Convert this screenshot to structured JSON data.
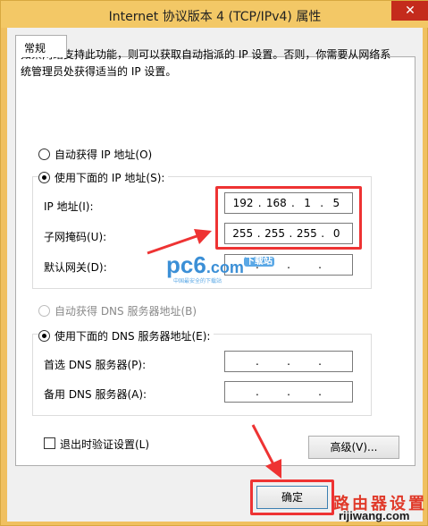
{
  "window": {
    "title": "Internet 协议版本 4 (TCP/IPv4) 属性",
    "close_glyph": "✕"
  },
  "tab": {
    "label": "常规"
  },
  "description": "如果网络支持此功能，则可以获取自动指派的 IP 设置。否则，你需要从网络系统管理员处获得适当的 IP 设置。",
  "ip_section": {
    "auto_label": "自动获得 IP 地址(O)",
    "manual_label": "使用下面的 IP 地址(S):",
    "manual_selected": true,
    "fields": [
      {
        "label": "IP 地址(I):",
        "octets": [
          "192",
          "168",
          "1",
          "5"
        ]
      },
      {
        "label": "子网掩码(U):",
        "octets": [
          "255",
          "255",
          "255",
          "0"
        ]
      },
      {
        "label": "默认网关(D):",
        "octets": [
          "",
          "",
          "",
          ""
        ]
      }
    ]
  },
  "dns_section": {
    "auto_label": "自动获得 DNS 服务器地址(B)",
    "manual_label": "使用下面的 DNS 服务器地址(E):",
    "fields": [
      {
        "label": "首选 DNS 服务器(P):",
        "octets": [
          "",
          "",
          "",
          ""
        ]
      },
      {
        "label": "备用 DNS 服务器(A):",
        "octets": [
          "",
          "",
          "",
          ""
        ]
      }
    ]
  },
  "validate_checkbox": {
    "label": "退出时验证设置(L)",
    "checked": false
  },
  "buttons": {
    "advanced": "高级(V)...",
    "ok": "确定"
  },
  "watermarks": {
    "pc6": "pc6",
    "pc6_com": ".com",
    "pc6_badge": "下载站",
    "pc6_sub": "中国最安全的下载站",
    "router": "路由器设置",
    "site": "rijiwang.com"
  },
  "colors": {
    "highlight": "#e33333",
    "title_bar": "#f3c866",
    "close_button": "#c42b1c"
  }
}
